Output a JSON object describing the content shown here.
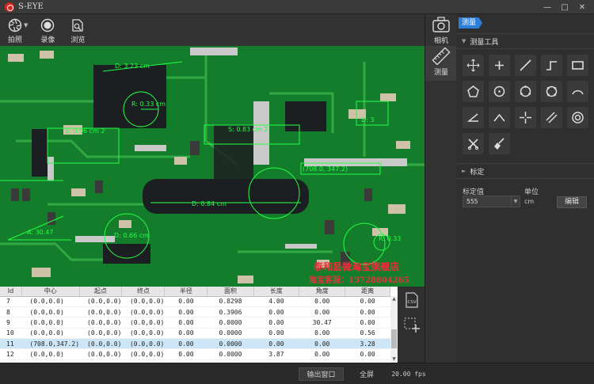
{
  "window": {
    "title": "S-EYE",
    "controls": [
      "—",
      "□",
      "✕"
    ]
  },
  "toolbar": {
    "items": [
      {
        "label": "拍照",
        "icon": "aperture-icon"
      },
      {
        "label": "录像",
        "icon": "record-icon"
      },
      {
        "label": "浏览",
        "icon": "browse-icon"
      }
    ]
  },
  "viewport": {
    "annotations": [
      "D: 3.23 cm",
      "R: 0.33 cm",
      "S: 0.06 cm 2",
      "S: 0.83 cm 2",
      "D: 0.84 cm",
      "D: 0.66 cm",
      "A: 30.47",
      "D: 3",
      "R: 0.33",
      "(708.0, 347.2)"
    ],
    "watermark": [
      "泰和显微淘宝旗舰店",
      "淘宝客服：13728804265"
    ]
  },
  "table": {
    "columns": [
      "Id",
      "中心",
      "起点",
      "终点",
      "半径",
      "面积",
      "长度",
      "角度",
      "距离"
    ],
    "rows": [
      [
        "7",
        "(0.0,0.0)",
        "(0.0,0.0)",
        "(0.0,0.0)",
        "0.00",
        "0.8298",
        "4.00",
        "0.00",
        "0.00"
      ],
      [
        "8",
        "(0.0,0.0)",
        "(0.0,0.0)",
        "(0.0,0.0)",
        "0.00",
        "0.3906",
        "0.00",
        "0.00",
        "0.00"
      ],
      [
        "9",
        "(0.0,0.0)",
        "(0.0,0.0)",
        "(0.0,0.0)",
        "0.00",
        "0.0000",
        "0.00",
        "30.47",
        "0.00"
      ],
      [
        "10",
        "(0.0,0.0)",
        "(0.0,0.0)",
        "(0.0,0.0)",
        "0.00",
        "0.0000",
        "0.00",
        "0.00",
        "0.56"
      ],
      [
        "11",
        "(708.0,347.2)",
        "(0.0,0.0)",
        "(0.0,0.0)",
        "0.00",
        "0.0000",
        "0.00",
        "0.00",
        "3.28"
      ],
      [
        "12",
        "(0.0,0.0)",
        "(0.0,0.0)",
        "(0.0,0.0)",
        "0.00",
        "0.0000",
        "3.87",
        "0.00",
        "0.00"
      ]
    ],
    "selected_row": 4
  },
  "statusbar": {
    "output_window": "输出窗口",
    "fullscreen": "全屏",
    "fps": "20.00 fps"
  },
  "rail": {
    "camera_label": "相机",
    "measure_label": "测量"
  },
  "panel": {
    "tab_label": "测量",
    "tools_section": "测量工具",
    "calibration_section": "标定",
    "calib_value_label": "标定值",
    "calib_value": "555",
    "unit_label": "单位",
    "unit_value": "cm",
    "edit_button": "编辑",
    "tools": [
      "move-tool-icon",
      "point-tool-icon",
      "line-tool-icon",
      "polyline-tool-icon",
      "rectangle-tool-icon",
      "polygon-tool-icon",
      "circle-center-tool-icon",
      "circle-3pt-tool-icon",
      "circle-fit-tool-icon",
      "arc-tool-icon",
      "angle-tool-icon",
      "angle-3pt-tool-icon",
      "cross-tool-icon",
      "parallel-lines-tool-icon",
      "concentric-circles-tool-icon",
      "delete-tool-icon",
      "clear-all-tool-icon"
    ]
  },
  "colors": {
    "accent": "#2b7fd6",
    "pcb": "#1a7a2e",
    "measure_line": "#22ff44",
    "watermark": "#e8303a"
  }
}
